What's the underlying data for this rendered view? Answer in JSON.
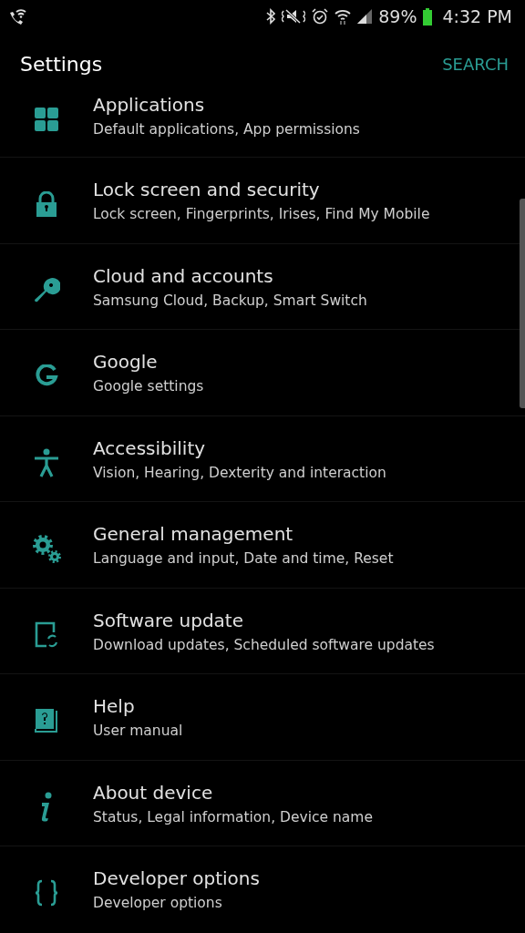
{
  "status_bar": {
    "battery": "89%",
    "time": "4:32 PM"
  },
  "header": {
    "title": "Settings",
    "action": "SEARCH"
  },
  "items": [
    {
      "title": "Applications",
      "subtitle": "Default applications, App permissions"
    },
    {
      "title": "Lock screen and security",
      "subtitle": "Lock screen, Fingerprints, Irises, Find My Mobile"
    },
    {
      "title": "Cloud and accounts",
      "subtitle": "Samsung Cloud, Backup, Smart Switch"
    },
    {
      "title": "Google",
      "subtitle": "Google settings"
    },
    {
      "title": "Accessibility",
      "subtitle": "Vision, Hearing, Dexterity and interaction"
    },
    {
      "title": "General management",
      "subtitle": "Language and input, Date and time, Reset"
    },
    {
      "title": "Software update",
      "subtitle": "Download updates, Scheduled software updates"
    },
    {
      "title": "Help",
      "subtitle": "User manual"
    },
    {
      "title": "About device",
      "subtitle": "Status, Legal information, Device name"
    },
    {
      "title": "Developer options",
      "subtitle": "Developer options"
    }
  ]
}
